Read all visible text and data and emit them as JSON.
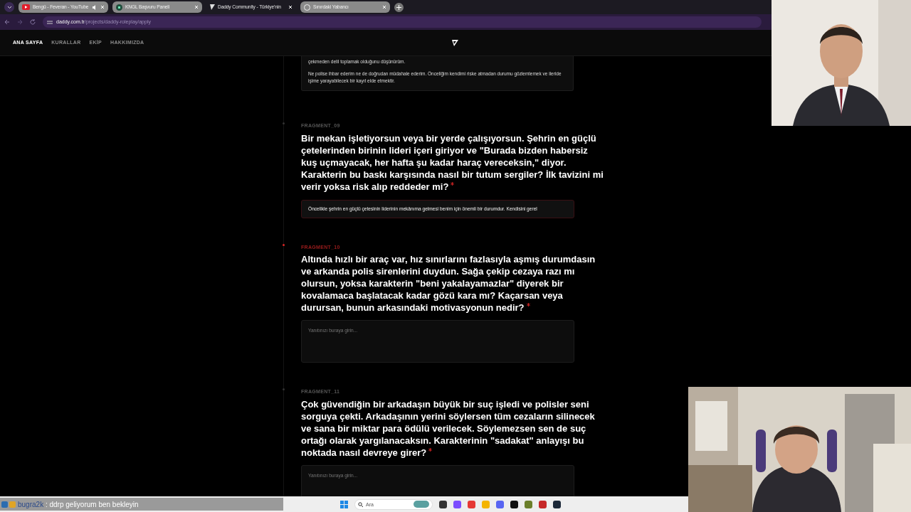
{
  "browser": {
    "tabs": [
      {
        "title": "Bengü - Feveran - YouTube",
        "selected": false,
        "audio": true,
        "kind": "video"
      },
      {
        "title": "KNGL Başvuru Paneli",
        "selected": false,
        "audio": false,
        "kind": "panel"
      },
      {
        "title": "Daddy Community - Türkiye'nin",
        "selected": true,
        "audio": false,
        "kind": "daddy"
      },
      {
        "title": "Sınırdaki Yabancı",
        "selected": false,
        "audio": false,
        "kind": "globe"
      }
    ],
    "url": {
      "domain": "daddy.com.tr",
      "path": "/projects/daddy-roleplay/apply"
    }
  },
  "nav": {
    "items": [
      {
        "label": "ANA SAYFA",
        "selected": true
      },
      {
        "label": "KURALLAR",
        "selected": false
      },
      {
        "label": "EKİP",
        "selected": false
      },
      {
        "label": "HAKKIMIZDA",
        "selected": false
      }
    ]
  },
  "form": {
    "previous_answer": [
      "çekmeden delil toplamak olduğunu düşünürüm.",
      "Ne polise ihbar ederim ne de doğrudan müdahale ederim. Önceliğim kendimi riske atmadan durumu gözlemlemek ve ileride işime yarayabilecek bir kayıt elde etmektir."
    ],
    "questions": [
      {
        "fragment": "FRAGMENT_09",
        "active": false,
        "required": true,
        "question": "Bir mekan işletiyorsun veya bir yerde çalışıyorsun. Şehrin en güçlü çetelerinden birinin lideri içeri giriyor ve \"Burada bizden habersiz kuş uçmayacak, her hafta şu kadar haraç vereceksin,\" diyor. Karakterin bu baskı karşısında nasıl bir tutum sergiler? İlk tavizini mi verir yoksa risk alıp reddeder mi?",
        "kind": "line",
        "value": "Öncelikle şehrin en güçlü çetesinin liderinin mekânıma gelmesi benim için önemli bir durumdur. Kendisini gerel"
      },
      {
        "fragment": "FRAGMENT_10",
        "active": true,
        "required": true,
        "question": "Altında hızlı bir araç var, hız sınırlarını fazlasıyla aşmış durumdasın ve arkanda polis sirenlerini duydun. Sağa çekip cezaya razı mı olursun, yoksa karakterin \"beni yakalayamazlar\" diyerek bir kovalamaca başlatacak kadar gözü kara mı? Kaçarsan veya durursan, bunun arkasındaki motivasyonun nedir?",
        "kind": "area",
        "placeholder": "Yanıtınızı buraya girin..."
      },
      {
        "fragment": "FRAGMENT_11",
        "active": false,
        "required": true,
        "question": "Çok güvendiğin bir arkadaşın büyük bir suç işledi ve polisler seni sorguya çekti. Arkadaşının yerini söylersen tüm cezaların silinecek ve sana bir miktar para ödülü verilecek. Söylemezsen sen de suç ortağı olarak yargılanacaksın. Karakterinin \"sadakat\" anlayışı bu noktada nasıl devreye girer?",
        "kind": "area",
        "placeholder": "Yanıtınızı buraya girin..."
      }
    ]
  },
  "chat": {
    "user": "bugra2k",
    "message": ": ddrp geliyorum ben bekleyin"
  },
  "taskbar": {
    "search": {
      "placeholder": "Ara"
    }
  }
}
